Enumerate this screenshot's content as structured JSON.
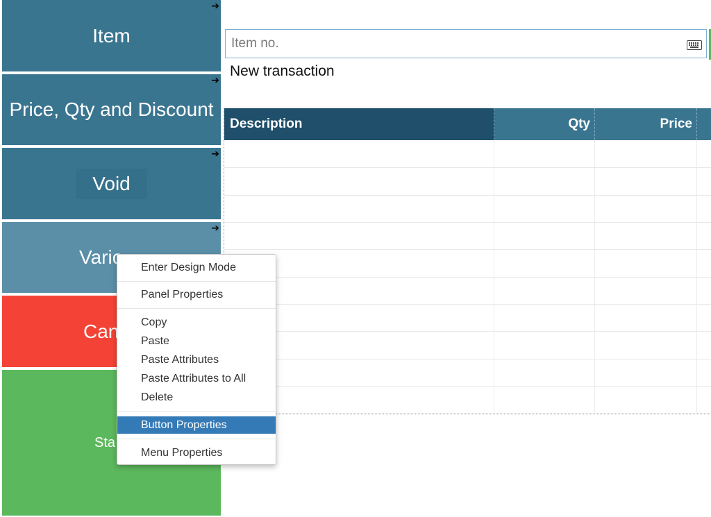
{
  "sidebar": {
    "buttons": [
      {
        "label": "Item",
        "arrow": "➔"
      },
      {
        "label": "Price, Qty and Discount",
        "arrow": "➔"
      },
      {
        "label": "Void",
        "arrow": "➔"
      },
      {
        "label": "Vario",
        "arrow": "➔"
      },
      {
        "label": "Can"
      },
      {
        "label": "Sta"
      }
    ]
  },
  "search": {
    "placeholder": "Item no.",
    "icon": "keyboard-icon"
  },
  "transaction_label": "New transaction",
  "grid": {
    "columns": [
      "Description",
      "Qty",
      "Price"
    ]
  },
  "context_menu": {
    "items": [
      "Enter Design Mode",
      "Panel Properties",
      "Copy",
      "Paste",
      "Paste Attributes",
      "Paste Attributes to All",
      "Delete",
      "Button Properties",
      "Menu Properties"
    ],
    "selected": "Button Properties"
  },
  "colors": {
    "teal": "#3a7590",
    "dark_header": "#1f4f6a",
    "red": "#f44336",
    "green": "#5cb85c",
    "highlight": "#337ab7"
  }
}
